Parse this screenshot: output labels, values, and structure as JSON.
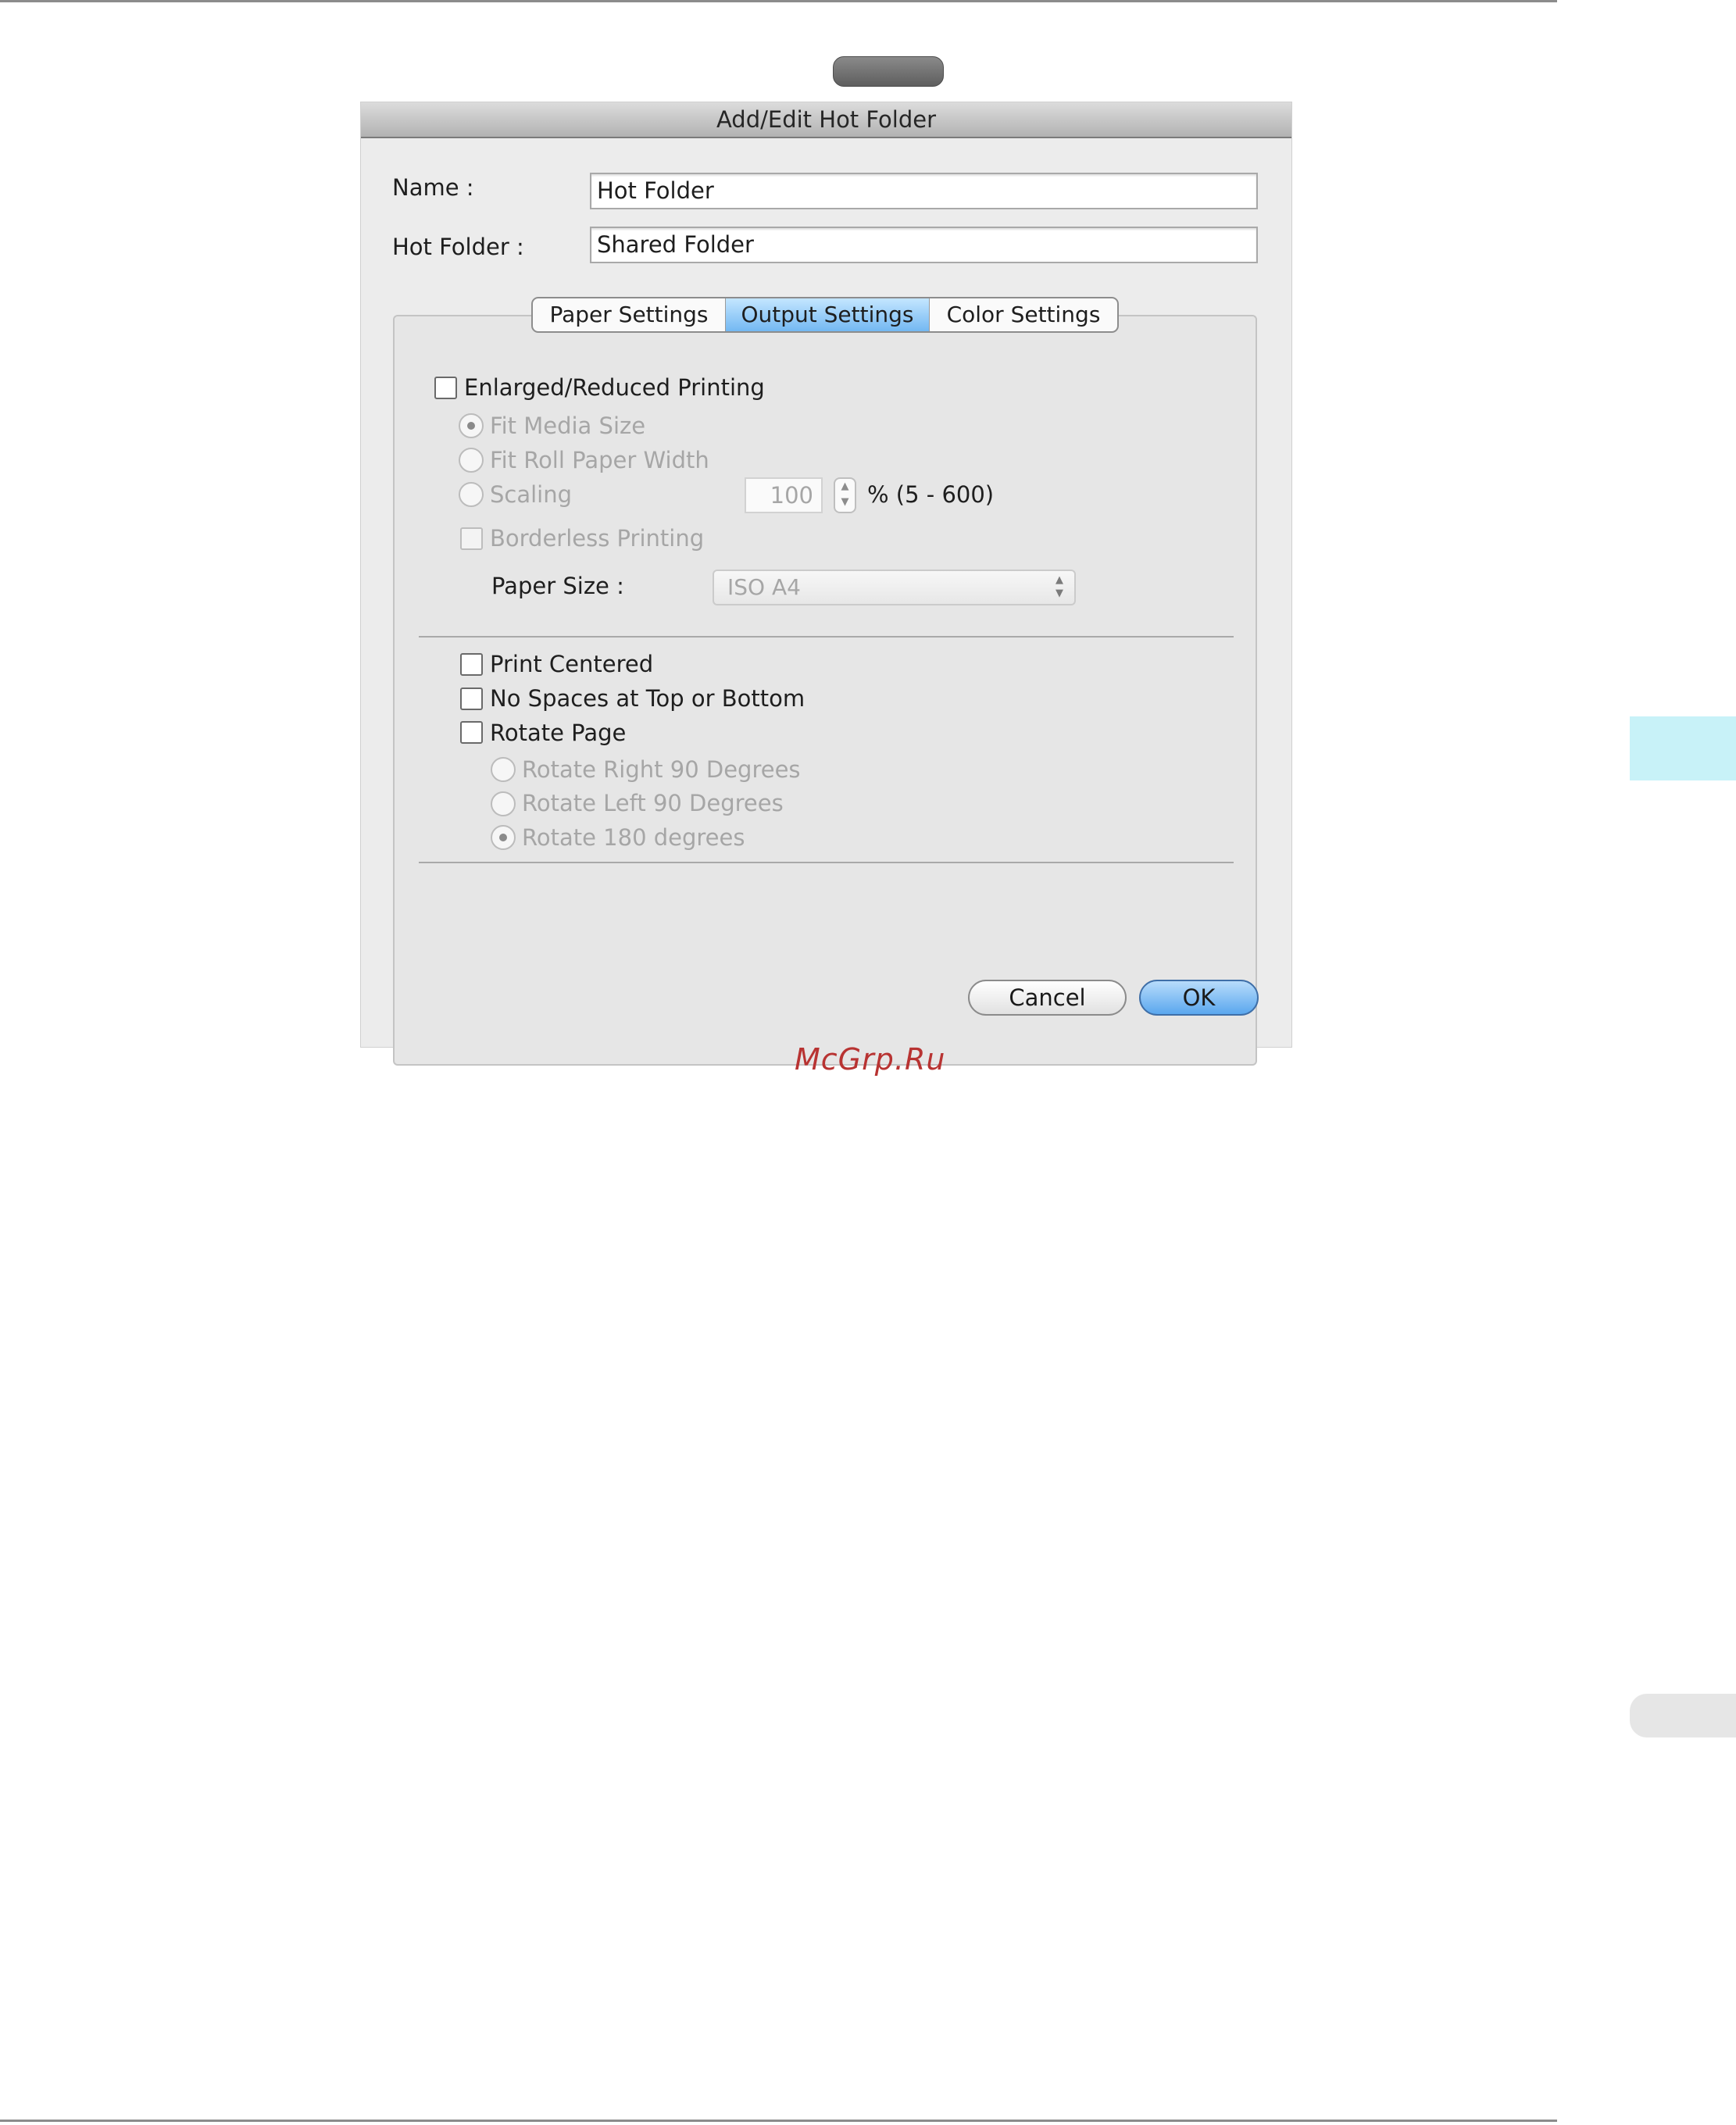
{
  "dialog": {
    "title": "Add/Edit Hot Folder",
    "name_label": "Name :",
    "name_value": "Hot Folder",
    "hot_folder_label": "Hot Folder :",
    "hot_folder_value": "Shared Folder"
  },
  "tabs": [
    {
      "label": "Paper Settings",
      "active": false
    },
    {
      "label": "Output Settings",
      "active": true
    },
    {
      "label": "Color Settings",
      "active": false
    }
  ],
  "output_settings": {
    "enlarged_reduced_label": "Enlarged/Reduced Printing",
    "enlarged_reduced_checked": false,
    "fit_media_size_label": "Fit Media Size",
    "fit_roll_paper_width_label": "Fit Roll Paper Width",
    "scaling_label": "Scaling",
    "selected_scaling_option": "Fit Media Size",
    "scaling_value": "100",
    "scaling_range": "% (5 - 600)",
    "borderless_printing_label": "Borderless Printing",
    "paper_size_label": "Paper Size :",
    "paper_size_value": "ISO A4",
    "print_centered_label": "Print Centered",
    "no_spaces_label": "No Spaces at Top or Bottom",
    "rotate_page_label": "Rotate Page",
    "rotate_right_label": "Rotate Right 90 Degrees",
    "rotate_left_label": "Rotate Left 90 Degrees",
    "rotate_180_label": "Rotate 180 degrees",
    "selected_rotation_option": "Rotate 180 degrees"
  },
  "buttons": {
    "cancel_label": "Cancel",
    "ok_label": "OK"
  },
  "watermark": "McGrp.Ru",
  "colors": {
    "active_tab": "#73b8f2",
    "ok_button": "#5aa7ee",
    "side_tab": "#c8f2f8",
    "watermark": "#b83332"
  }
}
